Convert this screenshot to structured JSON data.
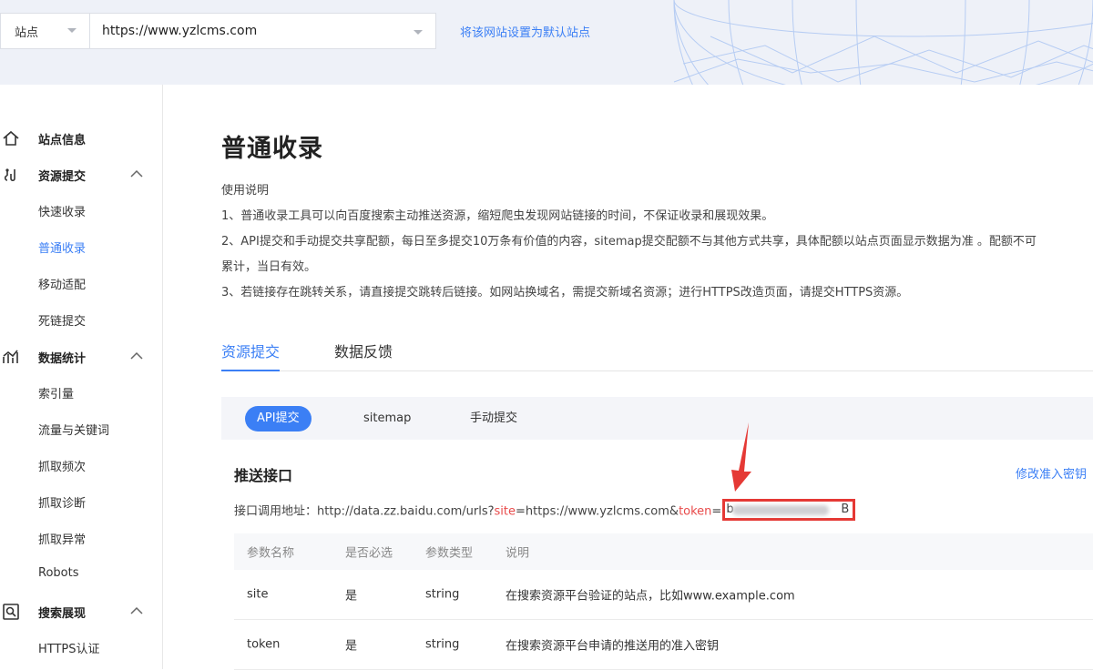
{
  "header": {
    "site_label": "站点",
    "site_url": "https://www.yzlcms.com",
    "set_default_link": "将该网站设置为默认站点"
  },
  "sidebar": {
    "site_info": "站点信息",
    "resource_submit": {
      "label": "资源提交",
      "items": [
        "快速收录",
        "普通收录",
        "移动适配",
        "死链提交"
      ]
    },
    "data_stats": {
      "label": "数据统计",
      "items": [
        "索引量",
        "流量与关键词",
        "抓取频次",
        "抓取诊断",
        "抓取异常",
        "Robots"
      ]
    },
    "search_display": {
      "label": "搜索展现",
      "items": [
        "HTTPS认证"
      ]
    }
  },
  "main": {
    "title": "普通收录",
    "instructions": [
      "使用说明",
      "1、普通收录工具可以向百度搜索主动推送资源，缩短爬虫发现网站链接的时间，不保证收录和展现效果。",
      "2、API提交和手动提交共享配额，每日至多提交10万条有价值的内容，sitemap提交配额不与其他方式共享，具体配额以站点页面显示数据为准 。配额不可",
      "累计，当日有效。",
      "3、若链接存在跳转关系，请直接提交跳转后链接。如网站换域名，需提交新域名资源；进行HTTPS改造页面，请提交HTTPS资源。"
    ],
    "tabs": [
      "资源提交",
      "数据反馈"
    ],
    "subtabs": [
      "API提交",
      "sitemap",
      "手动提交"
    ],
    "push": {
      "title": "推送接口",
      "modify_link": "修改准入密钥",
      "endpoint_prefix": "接口调用地址：http://data.zz.baidu.com/urls?",
      "site_param": "site",
      "site_value": "=https://www.yzlcms.com&",
      "token_param": "token",
      "token_eq": "=",
      "token_head": "b",
      "token_tail": "B"
    },
    "param_table": {
      "headers": [
        "参数名称",
        "是否必选",
        "参数类型",
        "说明"
      ],
      "rows": [
        [
          "site",
          "是",
          "string",
          "在搜索资源平台验证的站点，比如www.example.com"
        ],
        [
          "token",
          "是",
          "string",
          "在搜索资源平台申请的推送用的准入密钥"
        ]
      ]
    }
  },
  "colors": {
    "accent": "#3b7ff5",
    "highlight_box": "#e53935",
    "param_red": "#e84a4a"
  }
}
